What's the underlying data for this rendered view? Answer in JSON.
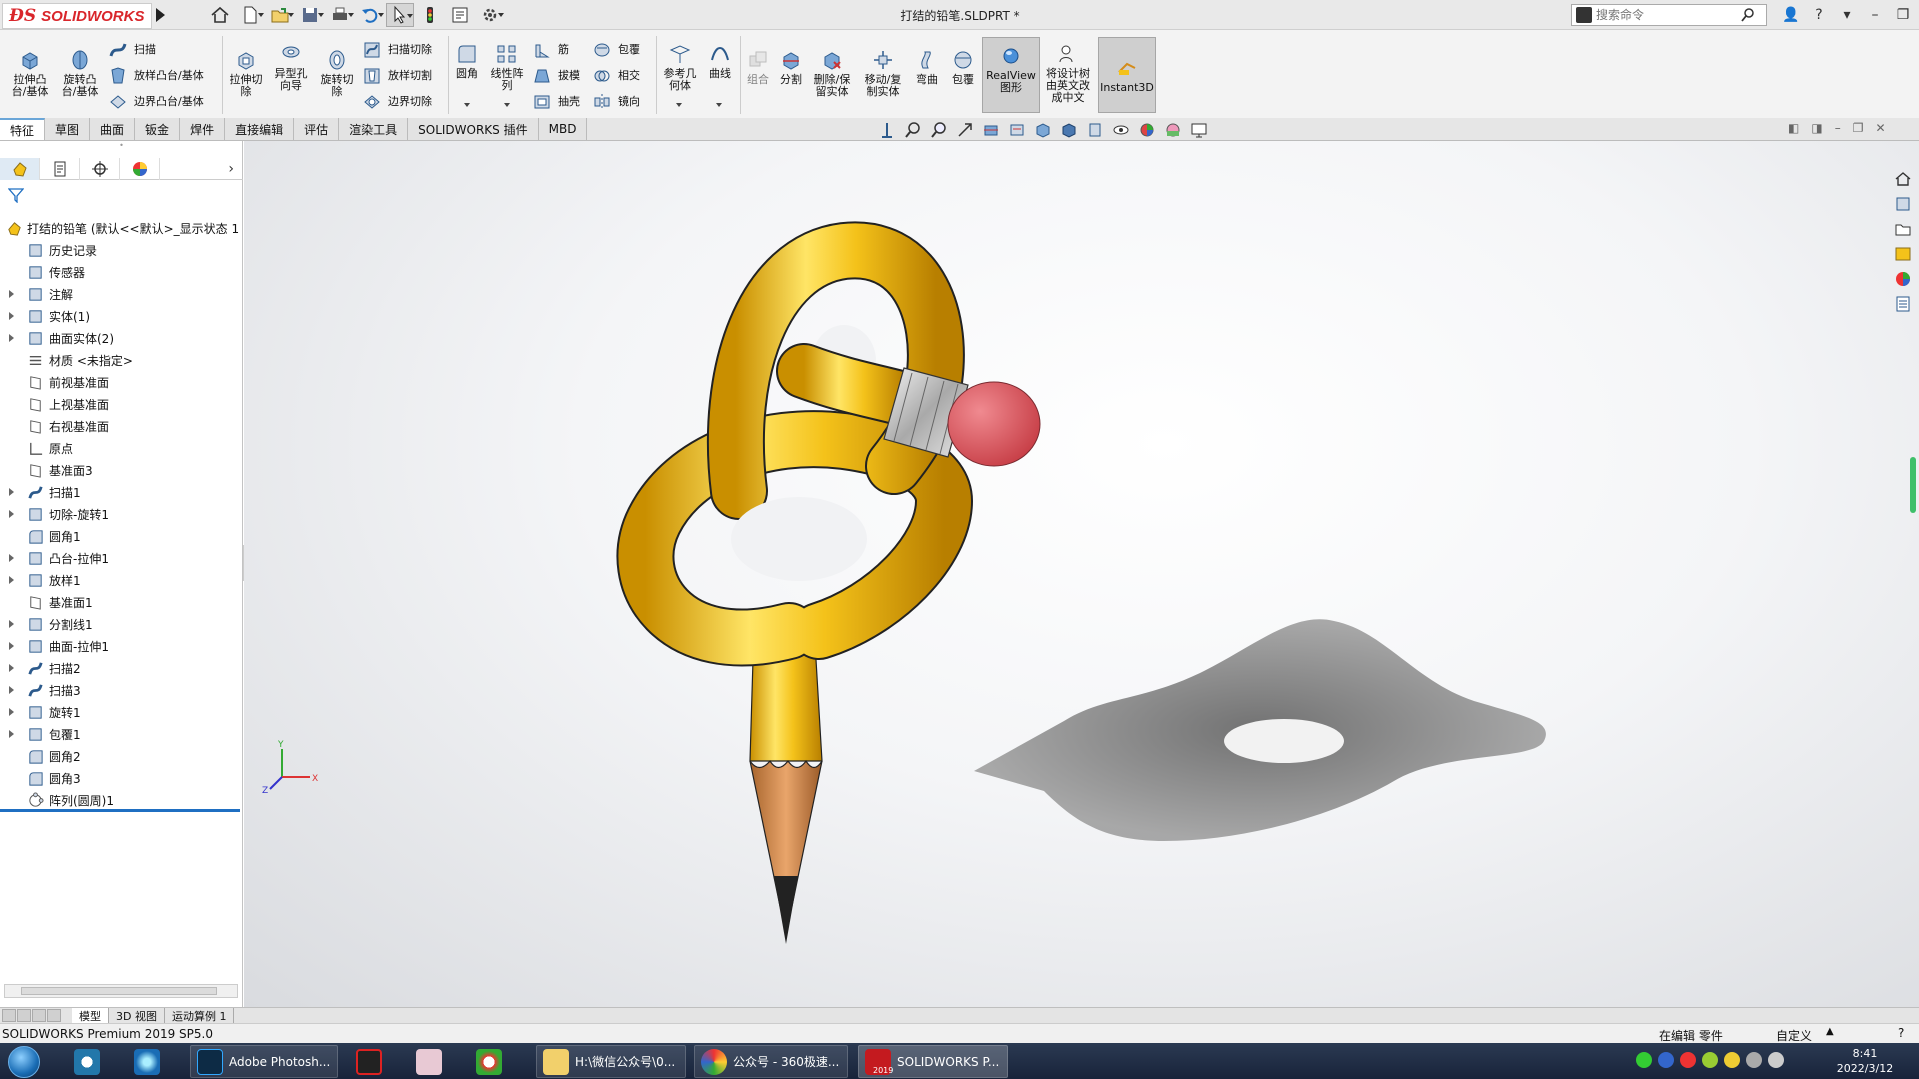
{
  "app": {
    "logo_text": "SOLIDWORKS",
    "document_title": "打结的铅笔.SLDPRT *",
    "search_placeholder": "搜索命令"
  },
  "command_manager": {
    "groups": [
      {
        "label": "拉伸凸台/基体"
      },
      {
        "label": "旋转凸台/基体"
      },
      {
        "label": "扫描"
      },
      {
        "label": "放样凸台/基体"
      },
      {
        "label": "边界凸台/基体"
      },
      {
        "label": "拉伸切除"
      },
      {
        "label": "异型孔向导"
      },
      {
        "label": "旋转切除"
      },
      {
        "label": "扫描切除"
      },
      {
        "label": "放样切割"
      },
      {
        "label": "边界切除"
      },
      {
        "label": "圆角"
      },
      {
        "label": "线性阵列"
      },
      {
        "label": "筋"
      },
      {
        "label": "拔模"
      },
      {
        "label": "抽壳"
      },
      {
        "label": "包覆"
      },
      {
        "label": "相交"
      },
      {
        "label": "镜向"
      },
      {
        "label": "参考几何体"
      },
      {
        "label": "曲线"
      },
      {
        "label": "组合"
      },
      {
        "label": "分割"
      },
      {
        "label": "删除/保留实体"
      },
      {
        "label": "移动/复制实体"
      },
      {
        "label": "弯曲"
      },
      {
        "label": "包覆"
      },
      {
        "label": "RealView图形"
      },
      {
        "label": "将设计树由英文改成中文"
      },
      {
        "label": "Instant3D"
      }
    ]
  },
  "tabs": [
    "特征",
    "草图",
    "曲面",
    "钣金",
    "焊件",
    "直接编辑",
    "评估",
    "渲染工具",
    "SOLIDWORKS 插件",
    "MBD"
  ],
  "feature_tree": {
    "root": "打结的铅笔  (默认<<默认>_显示状态 1",
    "items": [
      {
        "label": "历史记录",
        "icon": "history-icon",
        "expandable": false
      },
      {
        "label": "传感器",
        "icon": "sensor-icon",
        "expandable": false
      },
      {
        "label": "注解",
        "icon": "annotation-icon",
        "expandable": true
      },
      {
        "label": "实体(1)",
        "icon": "solid-bodies-icon",
        "expandable": true
      },
      {
        "label": "曲面实体(2)",
        "icon": "surface-bodies-icon",
        "expandable": true
      },
      {
        "label": "材质 <未指定>",
        "icon": "material-icon",
        "expandable": false
      },
      {
        "label": "前视基准面",
        "icon": "plane-icon",
        "expandable": false
      },
      {
        "label": "上视基准面",
        "icon": "plane-icon",
        "expandable": false
      },
      {
        "label": "右视基准面",
        "icon": "plane-icon",
        "expandable": false
      },
      {
        "label": "原点",
        "icon": "origin-icon",
        "expandable": false
      },
      {
        "label": "基准面3",
        "icon": "plane-icon",
        "expandable": false
      },
      {
        "label": "扫描1",
        "icon": "sweep-icon",
        "expandable": true
      },
      {
        "label": "切除-旋转1",
        "icon": "revolve-cut-icon",
        "expandable": true
      },
      {
        "label": "圆角1",
        "icon": "fillet-icon",
        "expandable": false
      },
      {
        "label": "凸台-拉伸1",
        "icon": "extrude-icon",
        "expandable": true
      },
      {
        "label": "放样1",
        "icon": "loft-icon",
        "expandable": true
      },
      {
        "label": "基准面1",
        "icon": "plane-icon",
        "expandable": false
      },
      {
        "label": "分割线1",
        "icon": "split-line-icon",
        "expandable": true
      },
      {
        "label": "曲面-拉伸1",
        "icon": "surface-extrude-icon",
        "expandable": true
      },
      {
        "label": "扫描2",
        "icon": "sweep-icon",
        "expandable": true
      },
      {
        "label": "扫描3",
        "icon": "sweep-icon",
        "expandable": true
      },
      {
        "label": "旋转1",
        "icon": "revolve-icon",
        "expandable": true
      },
      {
        "label": "包覆1",
        "icon": "wrap-icon",
        "expandable": true
      },
      {
        "label": "圆角2",
        "icon": "fillet-icon",
        "expandable": false
      },
      {
        "label": "圆角3",
        "icon": "fillet-icon",
        "expandable": false
      },
      {
        "label": "阵列(圆周)1",
        "icon": "circular-pattern-icon",
        "expandable": false
      }
    ]
  },
  "bottom_tabs": [
    "模型",
    "3D 视图",
    "运动算例 1"
  ],
  "status": {
    "product": "SOLIDWORKS Premium 2019 SP5.0",
    "editing": "在编辑 零件",
    "units": "自定义"
  },
  "triad": {
    "x": "X",
    "y": "Y",
    "z": "Z"
  },
  "taskbar": {
    "apps": [
      {
        "label": "Adobe Photosh...",
        "icon": "photoshop-icon"
      },
      {
        "label": "H:\\微信公众号\\0...",
        "icon": "folder-icon"
      },
      {
        "label": "公众号 - 360极速...",
        "icon": "browser-360-icon"
      },
      {
        "label": "SOLIDWORKS P...",
        "icon": "solidworks-icon"
      }
    ],
    "solidworks_badge": "2019",
    "clock_time": "8:41",
    "clock_date": "2022/3/12"
  },
  "colors": {
    "pencil_yellow": "#f4c21a",
    "eraser_red": "#e0575e",
    "accent_blue": "#1f6fc2",
    "sw_red": "#d9262b"
  }
}
